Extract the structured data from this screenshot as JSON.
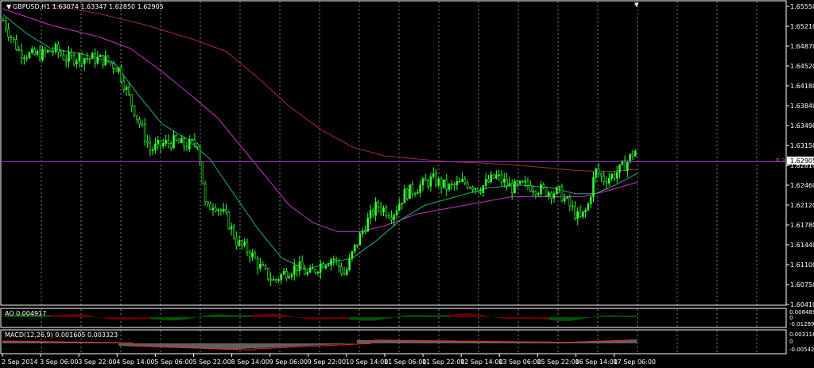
{
  "colors": {
    "background": "#000000",
    "grid": "#ffffff",
    "bull": "#33ff33",
    "bear": "#33ff33",
    "ma_fast": "#1fae7a",
    "ma_mid": "#cc33cc",
    "ma_slow": "#a5302a",
    "hline": "#9933cc",
    "current_box": "#ffffff",
    "current_text": "#000000",
    "ao_up": "#00a000",
    "ao_down": "#c00000",
    "macd_hist": "#c0c0c0",
    "macd_signal": "#ff2020"
  },
  "chart": {
    "header": "GBPUSD,H1  1.63074 1.63347 1.62850 1.62905",
    "current_price_label": "1.62905",
    "hline_price": 1.6285,
    "hline_label_text": "B:3",
    "y_axis_labels": [
      "1.65550",
      "1.65210",
      "1.64870",
      "1.64520",
      "1.64180",
      "1.63840",
      "1.63490",
      "1.63150",
      "1.62810",
      "1.62460",
      "1.62120",
      "1.61780",
      "1.61440",
      "1.61100",
      "1.60750",
      "1.60410"
    ],
    "x_axis_labels": [
      "2 Sep 2014",
      "3 Sep 06:00",
      "3 Sep 22:00",
      "4 Sep 14:00",
      "5 Sep 06:00",
      "5 Sep 22:00",
      "8 Sep 14:00",
      "9 Sep 06:00",
      "9 Sep 22:00",
      "10 Sep 14:00",
      "11 Sep 06:00",
      "11 Sep 22:00",
      "12 Sep 14:00",
      "13 Sep 06:00",
      "15 Sep 22:00",
      "16 Sep 14:00",
      "17 Sep 06:00"
    ]
  },
  "ao": {
    "label": "AO 0.004917",
    "y_axis_labels": [
      "0.008489",
      "0",
      "-0.012890"
    ]
  },
  "macd": {
    "label": "MACD(12,26,9) 0.001605 0.003323",
    "y_axis_labels": [
      "0.003116",
      "0",
      "-0.005427"
    ]
  },
  "chart_data": {
    "type": "candlestick",
    "title": "GBPUSD,H1",
    "ohlc_last": {
      "open": 1.63074,
      "high": 1.63347,
      "low": 1.6285,
      "close": 1.62905
    },
    "ylim": [
      1.6041,
      1.6555
    ],
    "close_path": [
      [
        0,
        1.6528
      ],
      [
        8,
        1.6505
      ],
      [
        20,
        1.6475
      ],
      [
        35,
        1.6468
      ],
      [
        50,
        1.647
      ],
      [
        65,
        1.6478
      ],
      [
        80,
        1.6462
      ],
      [
        95,
        1.6465
      ],
      [
        110,
        1.6463
      ],
      [
        130,
        1.646
      ],
      [
        145,
        1.6445
      ],
      [
        160,
        1.639
      ],
      [
        175,
        1.634
      ],
      [
        185,
        1.6305
      ],
      [
        200,
        1.6315
      ],
      [
        215,
        1.632
      ],
      [
        230,
        1.6312
      ],
      [
        245,
        1.632
      ],
      [
        255,
        1.62
      ],
      [
        265,
        1.6215
      ],
      [
        280,
        1.619
      ],
      [
        295,
        1.6145
      ],
      [
        310,
        1.613
      ],
      [
        325,
        1.61
      ],
      [
        340,
        1.608
      ],
      [
        355,
        1.6095
      ],
      [
        370,
        1.6105
      ],
      [
        385,
        1.609
      ],
      [
        400,
        1.611
      ],
      [
        415,
        1.612
      ],
      [
        430,
        1.609
      ],
      [
        440,
        1.613
      ],
      [
        455,
        1.6175
      ],
      [
        470,
        1.621
      ],
      [
        490,
        1.6195
      ],
      [
        505,
        1.623
      ],
      [
        520,
        1.624
      ],
      [
        540,
        1.6255
      ],
      [
        560,
        1.624
      ],
      [
        580,
        1.625
      ],
      [
        600,
        1.624
      ],
      [
        620,
        1.626
      ],
      [
        640,
        1.624
      ],
      [
        660,
        1.6245
      ],
      [
        680,
        1.6235
      ],
      [
        700,
        1.6232
      ],
      [
        715,
        1.6205
      ],
      [
        725,
        1.6185
      ],
      [
        735,
        1.6205
      ],
      [
        745,
        1.627
      ],
      [
        755,
        1.6255
      ],
      [
        765,
        1.626
      ],
      [
        775,
        1.627
      ],
      [
        785,
        1.6285
      ],
      [
        795,
        1.6305
      ],
      [
        798,
        1.629
      ]
    ],
    "ma_fast": [
      [
        0,
        1.6538
      ],
      [
        30,
        1.6505
      ],
      [
        60,
        1.648
      ],
      [
        100,
        1.647
      ],
      [
        140,
        1.6455
      ],
      [
        170,
        1.64
      ],
      [
        200,
        1.635
      ],
      [
        230,
        1.6325
      ],
      [
        260,
        1.629
      ],
      [
        290,
        1.623
      ],
      [
        320,
        1.617
      ],
      [
        350,
        1.612
      ],
      [
        380,
        1.61
      ],
      [
        410,
        1.611
      ],
      [
        440,
        1.612
      ],
      [
        470,
        1.615
      ],
      [
        500,
        1.6185
      ],
      [
        530,
        1.621
      ],
      [
        570,
        1.6225
      ],
      [
        610,
        1.624
      ],
      [
        650,
        1.6245
      ],
      [
        690,
        1.624
      ],
      [
        720,
        1.623
      ],
      [
        745,
        1.623
      ],
      [
        770,
        1.6245
      ],
      [
        798,
        1.6265
      ]
    ],
    "ma_mid": [
      [
        0,
        1.6548
      ],
      [
        60,
        1.652
      ],
      [
        120,
        1.65
      ],
      [
        160,
        1.648
      ],
      [
        200,
        1.644
      ],
      [
        240,
        1.6395
      ],
      [
        270,
        1.636
      ],
      [
        300,
        1.631
      ],
      [
        330,
        1.626
      ],
      [
        360,
        1.621
      ],
      [
        390,
        1.618
      ],
      [
        420,
        1.6165
      ],
      [
        450,
        1.6165
      ],
      [
        480,
        1.6175
      ],
      [
        520,
        1.6195
      ],
      [
        560,
        1.6205
      ],
      [
        600,
        1.6215
      ],
      [
        640,
        1.6225
      ],
      [
        690,
        1.6225
      ],
      [
        730,
        1.6225
      ],
      [
        760,
        1.6235
      ],
      [
        798,
        1.625
      ]
    ],
    "ma_slow": [
      [
        60,
        1.6555
      ],
      [
        120,
        1.654
      ],
      [
        180,
        1.652
      ],
      [
        240,
        1.6495
      ],
      [
        280,
        1.6475
      ],
      [
        320,
        1.643
      ],
      [
        360,
        1.638
      ],
      [
        400,
        1.634
      ],
      [
        440,
        1.631
      ],
      [
        480,
        1.6295
      ],
      [
        520,
        1.629
      ],
      [
        560,
        1.6285
      ],
      [
        600,
        1.6283
      ],
      [
        640,
        1.628
      ],
      [
        680,
        1.6275
      ],
      [
        720,
        1.627
      ],
      [
        760,
        1.6268
      ],
      [
        798,
        1.6272
      ]
    ]
  }
}
